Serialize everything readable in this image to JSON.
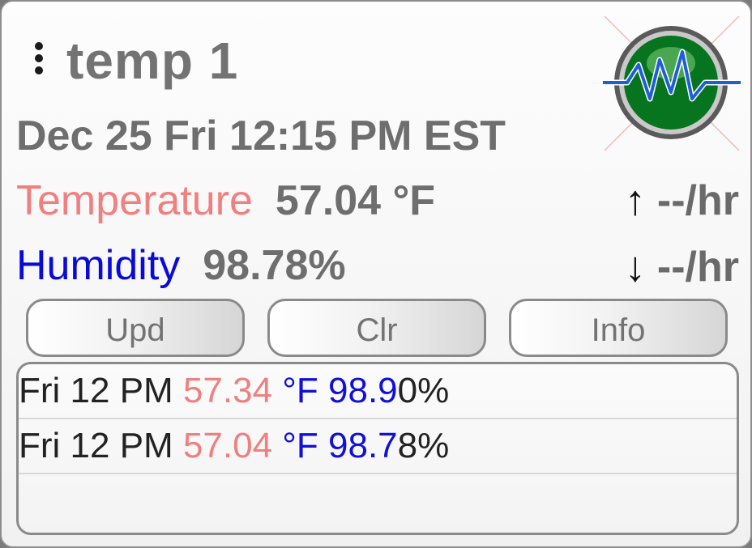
{
  "title": "temp 1",
  "datetime": "Dec 25 Fri 12:15 PM EST",
  "temperature": {
    "label": "Temperature",
    "value": "57.04 °F",
    "rate": "--/hr",
    "rate_arrow": "↑"
  },
  "humidity": {
    "label": "Humidity",
    "value": "98.78%",
    "rate": "--/hr",
    "rate_arrow": "↓"
  },
  "buttons": {
    "update": "Upd",
    "clear": "Clr",
    "info": "Info"
  },
  "log": [
    {
      "time": "Fri 12 PM",
      "temp": "57.34",
      "unit": "°F",
      "hum_a": "98.9",
      "hum_b": "0%"
    },
    {
      "time": "Fri 12 PM",
      "temp": "57.04",
      "unit": "°F",
      "hum_a": "98.7",
      "hum_b": "8%"
    }
  ],
  "colors": {
    "temp_label": "#f08080",
    "humidity_label": "#0a0ad8",
    "logo_green": "#0a7a2a",
    "logo_wave": "#1e5fd6"
  },
  "icons": {
    "menu": "vertical-ellipsis-icon",
    "logo": "heartbeat-logo-icon",
    "rate_up": "arrow-up-icon",
    "rate_down": "arrow-down-icon"
  }
}
